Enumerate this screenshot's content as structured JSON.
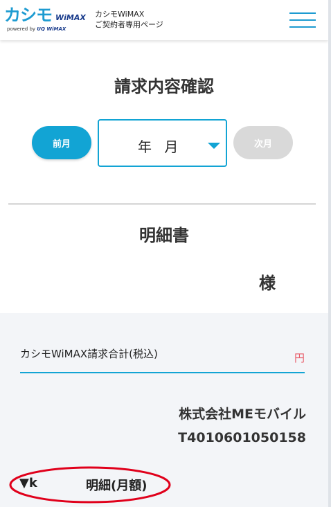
{
  "header": {
    "logo_main": "カシモ",
    "logo_wimax": "WiMAX",
    "logo_powered": "powered by",
    "logo_uq": "UQ WiMAX",
    "site_title_line1": "カシモWiMAX",
    "site_title_line2": "ご契約者専用ページ",
    "menu_icon": "hamburger-icon"
  },
  "page": {
    "title": "請求内容確認"
  },
  "month_nav": {
    "prev_label": "前月",
    "selected_value": "年 月",
    "next_label": "次月"
  },
  "statement": {
    "title": "明細書",
    "customer_suffix": "様",
    "total_label": "カシモWiMAX請求合計(税込)",
    "total_unit": "円",
    "company": "株式会社MEモバイル",
    "registration_number": "T4010601050158",
    "detail_toggle_mark": "▼k",
    "detail_toggle_label": "明細(月額)"
  },
  "colors": {
    "accent": "#12a4d4",
    "brand_blue": "#1d9bd1",
    "disabled": "#d9d9d9",
    "yen": "#e85d6a",
    "annotation": "#e0001b"
  }
}
